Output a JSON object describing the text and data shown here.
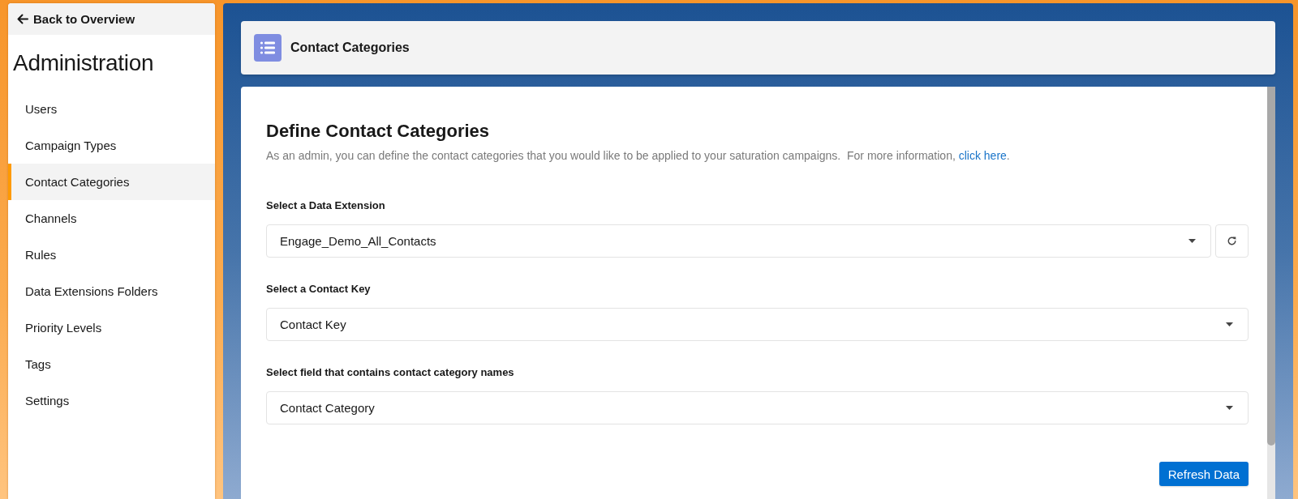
{
  "sidebar": {
    "back_link": "Back to Overview",
    "title": "Administration",
    "items": [
      {
        "label": "Users",
        "selected": false
      },
      {
        "label": "Campaign Types",
        "selected": false
      },
      {
        "label": "Contact Categories",
        "selected": true
      },
      {
        "label": "Channels",
        "selected": false
      },
      {
        "label": "Rules",
        "selected": false
      },
      {
        "label": "Data Extensions Folders",
        "selected": false
      },
      {
        "label": "Priority Levels",
        "selected": false
      },
      {
        "label": "Tags",
        "selected": false
      },
      {
        "label": "Settings",
        "selected": false
      }
    ]
  },
  "header": {
    "title": "Contact Categories"
  },
  "content": {
    "heading": "Define Contact Categories",
    "description": "As an admin, you can define the contact categories that you would like to be applied to your saturation campaigns.  For more information, ",
    "link": "click here",
    "description_end": ".",
    "fields": [
      {
        "kind": "select_with_refresh",
        "label": "Select a Data Extension",
        "value": "Engage_Demo_All_Contacts"
      },
      {
        "kind": "select",
        "label": "Select a Contact Key",
        "value": "Contact Key"
      },
      {
        "kind": "select",
        "label": "Select field that contains contact category names",
        "value": "Contact Category"
      }
    ],
    "button": "Refresh Data"
  }
}
